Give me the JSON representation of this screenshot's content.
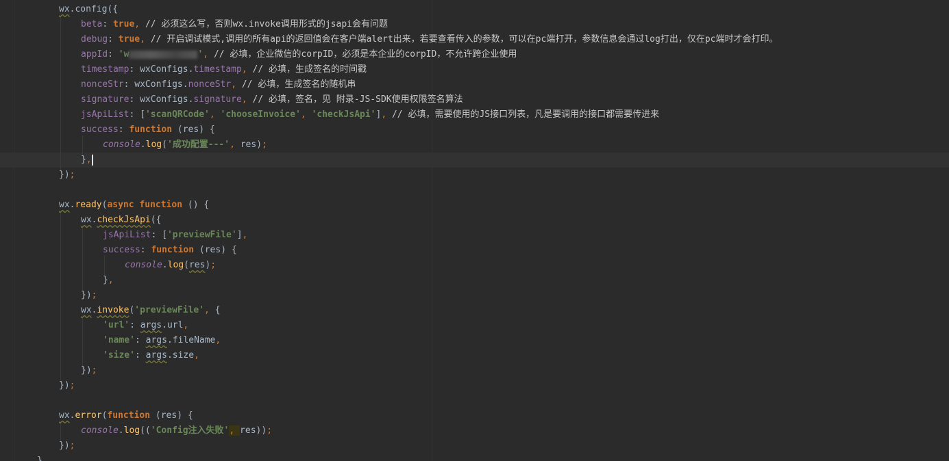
{
  "editor": {
    "line_config_open": "wx.config({",
    "beta": {
      "key": "beta",
      "value": "true",
      "comment": "// 必须这么写，否则wx.invoke调用形式的jsapi会有问题"
    },
    "debug": {
      "key": "debug",
      "value": "true",
      "comment": "// 开启调试模式,调用的所有api的返回值会在客户端alert出来，若要查看传入的参数，可以在pc端打开，参数信息会通过log打出，仅在pc端时才会打印。"
    },
    "appId": {
      "key": "appId",
      "value_prefix": "'w",
      "value_suffix": "'",
      "comment": "// 必填，企业微信的corpID，必须是本企业的corpID，不允许跨企业使用"
    },
    "timestamp": {
      "key": "timestamp",
      "obj": "wxConfigs",
      "field": "timestamp",
      "comment": "// 必填，生成签名的时间戳"
    },
    "nonceStr": {
      "key": "nonceStr",
      "obj": "wxConfigs",
      "field": "nonceStr",
      "comment": "// 必填，生成签名的随机串"
    },
    "signature": {
      "key": "signature",
      "obj": "wxConfigs",
      "field": "signature",
      "comment": "// 必填，签名，见 附录-JS-SDK使用权限签名算法"
    },
    "jsApiList": {
      "key": "jsApiList",
      "items": [
        "'scanQRCode'",
        "'chooseInvoice'",
        "'checkJsApi'"
      ],
      "comment": "// 必填，需要使用的JS接口列表，凡是要调用的接口都需要传进来"
    },
    "success_key": "success",
    "function_kw": "function",
    "res": "res",
    "console": "console",
    "log": "log",
    "success_log_str": "'成功配置---'",
    "ready_async": "async",
    "checkJsApi": "checkJsApi",
    "preview_file_str": "'previewFile'",
    "invoke": "invoke",
    "url_key": "'url'",
    "name_key": "'name'",
    "size_key": "'size'",
    "args": "args",
    "url_field": "url",
    "fileName_field": "fileName",
    "size_field": "size",
    "error": "error",
    "error_str": "'Config注入失败'",
    "wx": "wx",
    "config_fn": "config",
    "ready_fn": "ready"
  }
}
